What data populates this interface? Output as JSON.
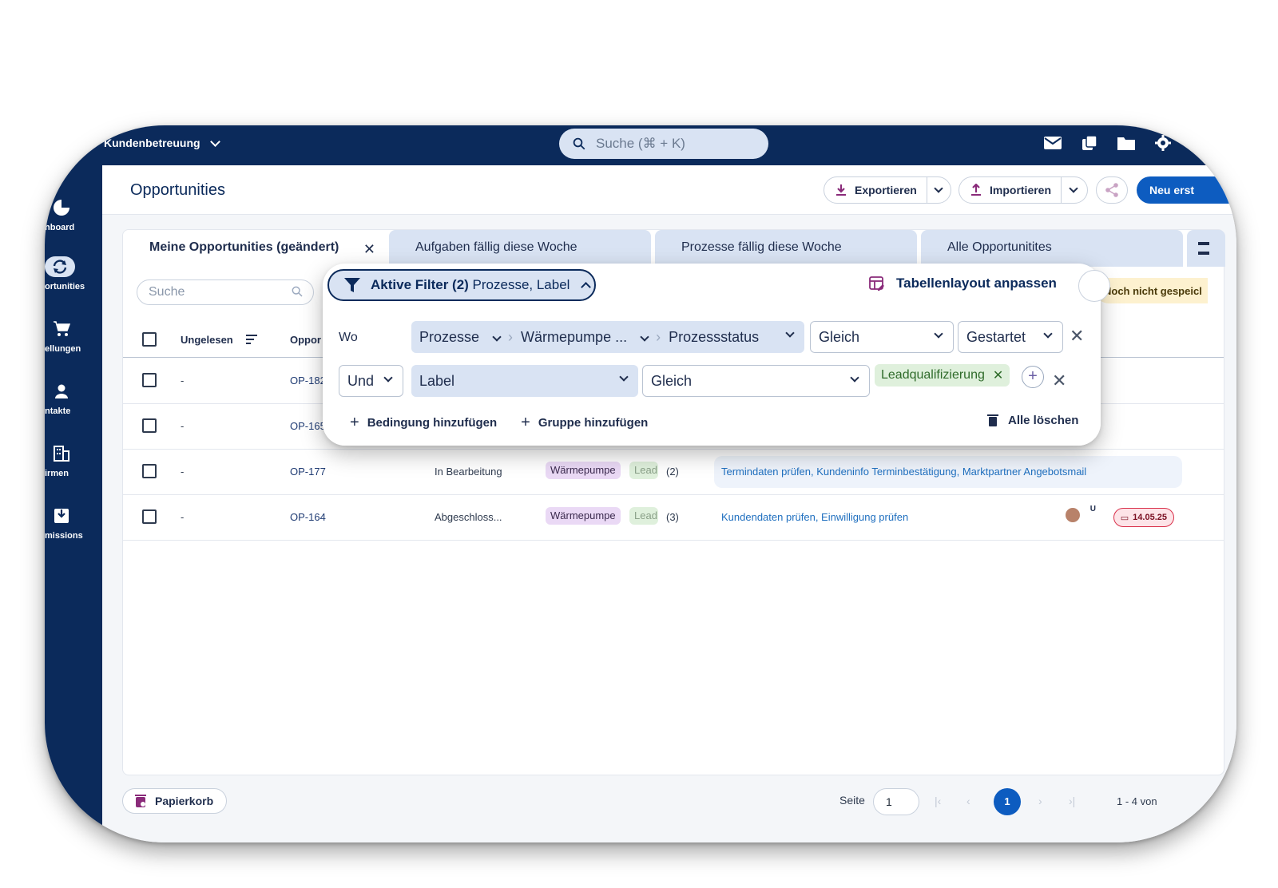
{
  "app": {
    "workspace": "Kundenbetreuung",
    "search_placeholder": "Suche (⌘ + K)"
  },
  "top_icons": [
    "mail-icon",
    "copy-icon",
    "folder-icon",
    "gear-icon"
  ],
  "sidebar": {
    "items": [
      {
        "label": "hboard",
        "icon": "dashboard-icon"
      },
      {
        "label": "ortunities",
        "icon": "sync-icon",
        "active": true
      },
      {
        "label": "ellungen",
        "icon": "cart-icon"
      },
      {
        "label": "ntakte",
        "icon": "person-icon"
      },
      {
        "label": "irmen",
        "icon": "building-icon"
      },
      {
        "label": "missions",
        "icon": "inbox-icon"
      }
    ]
  },
  "header": {
    "title": "Opportunities",
    "export_label": "Exportieren",
    "import_label": "Importieren",
    "new_label": "Neu erst"
  },
  "tabs": [
    {
      "label": "Meine Opportunities (geändert)",
      "active": true
    },
    {
      "label": "Aufgaben fällig diese Woche"
    },
    {
      "label": "Prozesse fällig diese Woche"
    },
    {
      "label": "Alle Opportunitites"
    }
  ],
  "list": {
    "search_placeholder": "Suche",
    "columns": {
      "unread": "Ungelesen",
      "opportunity": "Oppor"
    },
    "rows": [
      {
        "unread": "-",
        "id": "OP-182"
      },
      {
        "unread": "-",
        "id": "OP-165"
      },
      {
        "unread": "-",
        "id": "OP-177",
        "status": "In Bearbeitung",
        "process": "Wärmepumpe",
        "label": "Lead",
        "count": "(2)",
        "tasks": "Termindaten prüfen, Kundeninfo Terminbestätigung, Marktpartner Angebotsmail"
      },
      {
        "unread": "-",
        "id": "OP-164",
        "status": "Abgeschloss...",
        "process": "Wärmepumpe",
        "label": "Lead",
        "count": "(3)",
        "tasks": "Kundendaten prüfen, Einwilligung prüfen",
        "assignee": "U",
        "due": "14.05.25"
      }
    ]
  },
  "filter": {
    "chip_bold": "Aktive Filter (2)",
    "chip_rest": "Prozesse, Label",
    "layout_label": "Tabellenlayout anpassen",
    "unsaved_label": "Noch nicht gespeicl",
    "row1": {
      "prefix": "Wo",
      "field1": "Prozesse",
      "field2": "Wärmepumpe ...",
      "field3": "Prozessstatus",
      "operator": "Gleich",
      "value": "Gestartet"
    },
    "row2": {
      "prefix": "Und",
      "field": "Label",
      "operator": "Gleich",
      "value": "Leadqualifizierung"
    },
    "add_condition": "Bedingung hinzufügen",
    "add_group": "Gruppe hinzufügen",
    "delete_all": "Alle löschen"
  },
  "footer": {
    "trash_label": "Papierkorb",
    "page_label": "Seite",
    "page_value": "1",
    "current_page": "1",
    "range": "1 - 4 von"
  }
}
